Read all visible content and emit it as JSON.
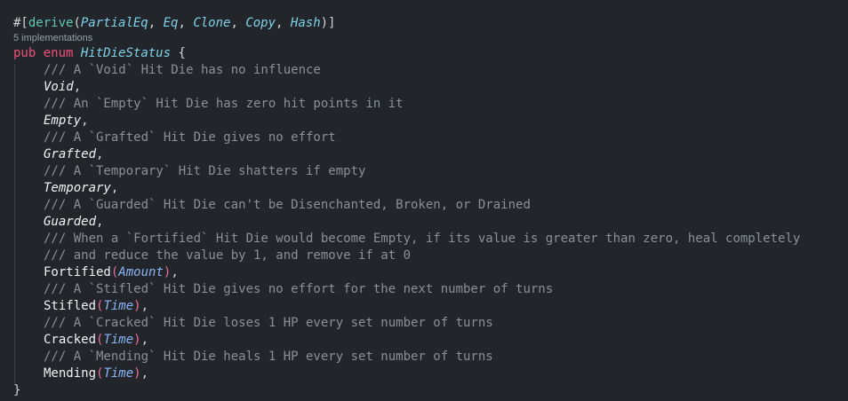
{
  "attribute": {
    "prefix": "#[",
    "name": "derive",
    "open": "(",
    "traits": [
      "PartialEq",
      "Eq",
      "Clone",
      "Copy",
      "Hash"
    ],
    "sep": ", ",
    "close": ")]"
  },
  "codelens": "5 implementations",
  "header": {
    "kw_pub": "pub",
    "kw_enum": "enum",
    "name": "HitDieStatus",
    "brace": "{"
  },
  "items": [
    {
      "comment": "/// A `Void` Hit Die has no influence",
      "variant": "Void",
      "param": ""
    },
    {
      "comment": "/// An `Empty` Hit Die has zero hit points in it",
      "variant": "Empty",
      "param": ""
    },
    {
      "comment": "/// A `Grafted` Hit Die gives no effort",
      "variant": "Grafted",
      "param": ""
    },
    {
      "comment": "/// A `Temporary` Hit Die shatters if empty",
      "variant": "Temporary",
      "param": ""
    },
    {
      "comment": "/// A `Guarded` Hit Die can't be Disenchanted, Broken, or Drained",
      "variant": "Guarded",
      "param": ""
    },
    {
      "comment": "/// When a `Fortified` Hit Die would become Empty, if its value is greater than zero, heal completely",
      "comment2": "/// and reduce the value by 1, and remove if at 0",
      "variant": "Fortified",
      "param": "Amount"
    },
    {
      "comment": "/// A `Stifled` Hit Die gives no effort for the next number of turns",
      "variant": "Stifled",
      "param": "Time"
    },
    {
      "comment": "/// A `Cracked` Hit Die loses 1 HP every set number of turns",
      "variant": "Cracked",
      "param": "Time"
    },
    {
      "comment": "/// A `Mending` Hit Die heals 1 HP every set number of turns",
      "variant": "Mending",
      "param": "Time"
    }
  ],
  "punct": {
    "comma": ",",
    "lparen": "(",
    "rparen": ")"
  },
  "footer": {
    "brace": "}"
  }
}
